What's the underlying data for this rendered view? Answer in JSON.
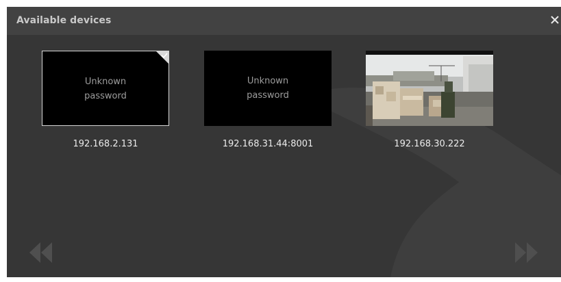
{
  "dialog": {
    "title": "Available devices",
    "close_icon": "close-icon"
  },
  "devices": [
    {
      "label": "192.168.2.131",
      "status_line1": "Unknown",
      "status_line2": "password",
      "selected": true,
      "preview": "none"
    },
    {
      "label": "192.168.31.44:8001",
      "status_line1": "Unknown",
      "status_line2": "password",
      "selected": false,
      "preview": "none"
    },
    {
      "label": "192.168.30.222",
      "selected": false,
      "preview": "camera-feed"
    }
  ],
  "navigation": {
    "prev_icon": "double-chevron-left-icon",
    "next_icon": "double-chevron-right-icon"
  },
  "colors": {
    "dialog_bg": "#363636",
    "titlebar_bg": "#424242",
    "title_text": "#c9c9c9",
    "label_text": "#ececec",
    "status_text": "#9d9d9d",
    "nav_icon": "#4f4f4f"
  }
}
